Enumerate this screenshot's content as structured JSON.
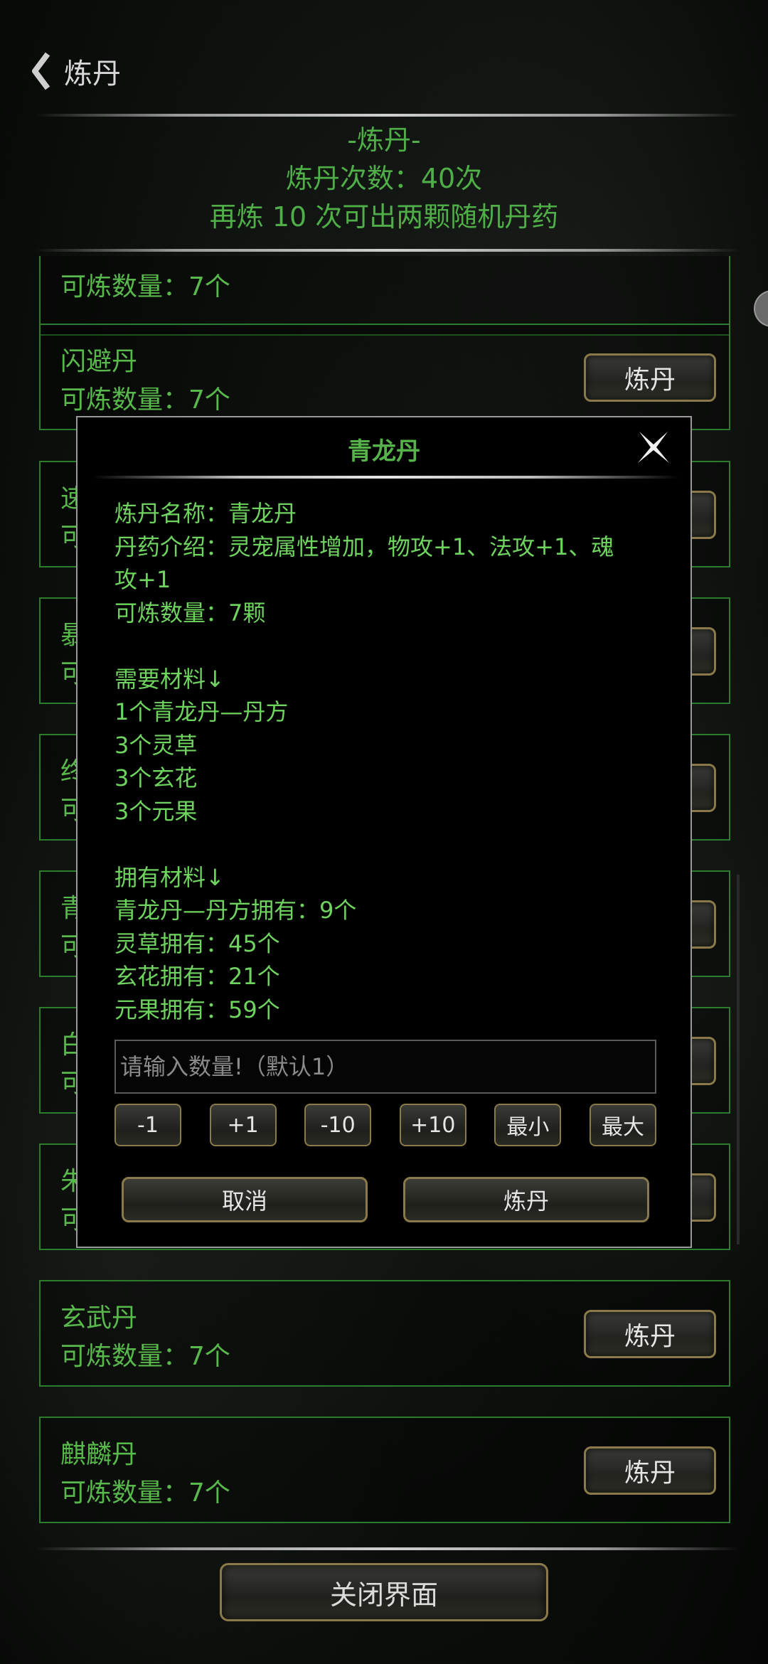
{
  "nav": {
    "title": "炼丹"
  },
  "header": {
    "label": "-炼丹-",
    "count_text": "炼丹次数：40次",
    "hint_text": "再炼 10 次可出两颗随机丹药"
  },
  "recipes": [
    {
      "name": "",
      "count": "可炼数量：7个",
      "button": "炼丹"
    },
    {
      "name": "闪避丹",
      "count": "可炼数量：7个",
      "button": "炼丹"
    },
    {
      "name": "速",
      "count": "可",
      "button": "炼丹"
    },
    {
      "name": "暴",
      "count": "可",
      "button": "炼丹"
    },
    {
      "name": "终",
      "count": "可",
      "button": "炼丹"
    },
    {
      "name": "青",
      "count": "可",
      "button": "炼丹"
    },
    {
      "name": "白",
      "count": "可",
      "button": "炼丹"
    },
    {
      "name": "朱",
      "count": "可",
      "button": "炼丹"
    },
    {
      "name": "玄武丹",
      "count": "可炼数量：7个",
      "button": "炼丹"
    },
    {
      "name": "麒麟丹",
      "count": "可炼数量：7个",
      "button": "炼丹"
    }
  ],
  "modal": {
    "title": "青龙丹",
    "lines": [
      "炼丹名称：青龙丹",
      "丹药介绍：灵宠属性增加，物攻+1、法攻+1、魂",
      "攻+1",
      "可炼数量：7颗",
      "",
      "需要材料↓",
      "1个青龙丹—丹方",
      "3个灵草",
      "3个玄花",
      "3个元果",
      "",
      "拥有材料↓",
      "青龙丹—丹方拥有：9个",
      "灵草拥有：45个",
      "玄花拥有：21个",
      "元果拥有：59个"
    ],
    "input_placeholder": "请输入数量!（默认1）",
    "steps": [
      "-1",
      "+1",
      "-10",
      "+10",
      "最小",
      "最大"
    ],
    "cancel_label": "取消",
    "confirm_label": "炼丹"
  },
  "footer": {
    "close_label": "关闭界面"
  },
  "colors": {
    "accent_green": "#56b34a",
    "gold_border": "#8a7a4a"
  },
  "icons": {
    "back": "back-chevron-icon",
    "close": "close-x-icon"
  }
}
